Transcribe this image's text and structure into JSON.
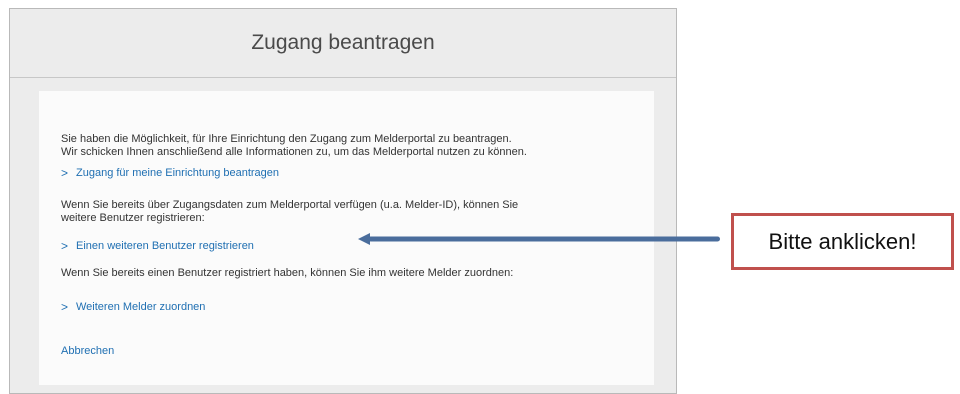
{
  "dialog": {
    "title": "Zugang beantragen",
    "intro_line1": "Sie haben die Möglichkeit, für Ihre Einrichtung den Zugang zum Melderportal zu beantragen.",
    "intro_line2": "Wir schicken Ihnen anschließend alle Informationen zu, um das Melderportal nutzen zu können.",
    "link_request_access": "Zugang für meine Einrichtung beantragen",
    "existing_line1": "Wenn Sie bereits über Zugangsdaten zum Melderportal verfügen (u.a. Melder-ID), können Sie",
    "existing_line2": "weitere Benutzer registrieren:",
    "link_register_user": "Einen weiteren Benutzer registrieren",
    "assign_text": "Wenn Sie bereits einen Benutzer registriert haben, können Sie ihm weitere Melder zuordnen:",
    "link_assign_reporter": "Weiteren Melder zuordnen",
    "cancel_label": "Abbrechen",
    "chevron_glyph": ">"
  },
  "annotation": {
    "callout_text": "Bitte anklicken!",
    "arrow_color": "#4a6d9c",
    "border_color": "#c0504d"
  },
  "colors": {
    "link": "#1f6fb2",
    "text": "#333333",
    "panel_bg": "#fbfbfb",
    "frame_bg": "#ececec"
  }
}
